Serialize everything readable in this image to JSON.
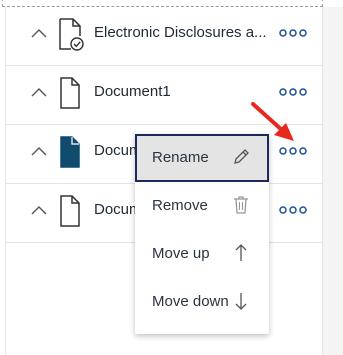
{
  "documents": [
    {
      "name": "Electronic Disclosures a...",
      "icon": "document-check-icon"
    },
    {
      "name": "Document1",
      "icon": "document-outline-icon"
    },
    {
      "name": "Docum",
      "icon": "document-filled-icon"
    },
    {
      "name": "Docum",
      "icon": "document-outline-icon"
    }
  ],
  "context_menu": {
    "items": [
      {
        "label": "Rename",
        "icon": "pencil-icon"
      },
      {
        "label": "Remove",
        "icon": "trash-icon"
      },
      {
        "label": "Move up",
        "icon": "arrow-up-icon"
      },
      {
        "label": "Move down",
        "icon": "arrow-down-icon"
      }
    ],
    "selected": "Rename"
  },
  "colors": {
    "accent": "#1c4f9c",
    "filled_doc": "#0f4c6e",
    "annotation_arrow": "#e8281e"
  }
}
